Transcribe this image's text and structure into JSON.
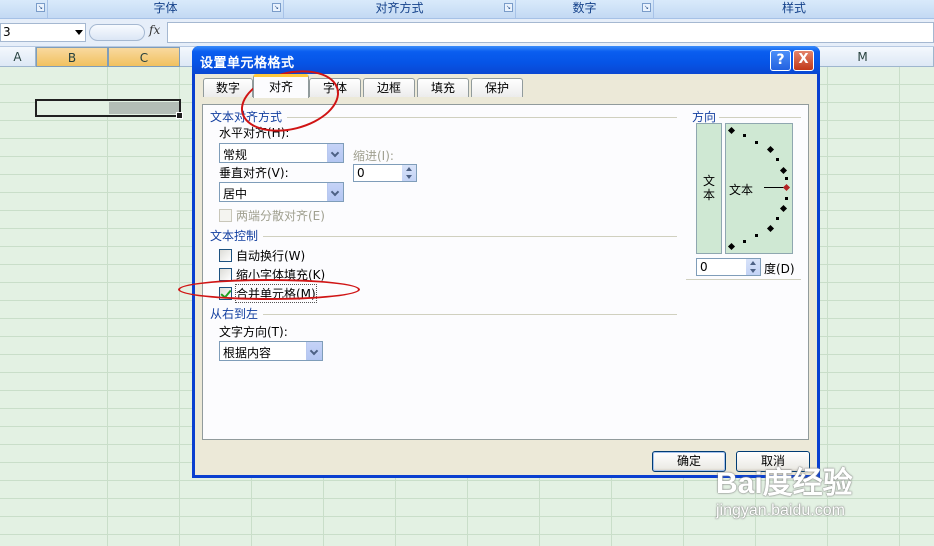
{
  "ribbon": {
    "groups": [
      "字体",
      "对齐方式",
      "数字",
      "样式"
    ]
  },
  "formula_bar": {
    "name_box": "3",
    "fx": "fx"
  },
  "columns": [
    "A",
    "B",
    "C",
    "M"
  ],
  "dialog": {
    "title": "设置单元格格式",
    "help_label": "?",
    "close_label": "X",
    "tabs": [
      "数字",
      "对齐",
      "字体",
      "边框",
      "填充",
      "保护"
    ],
    "active_tab": "对齐",
    "text_alignment": {
      "group_label": "文本对齐方式",
      "horizontal_label": "水平对齐(H):",
      "horizontal_value": "常规",
      "indent_label": "缩进(I):",
      "indent_value": "0",
      "vertical_label": "垂直对齐(V):",
      "vertical_value": "居中",
      "justify_distributed_label": "两端分散对齐(E)"
    },
    "text_control": {
      "group_label": "文本控制",
      "wrap_label": "自动换行(W)",
      "wrap_checked": false,
      "shrink_label": "缩小字体填充(K)",
      "shrink_checked": false,
      "merge_label": "合并单元格(M)",
      "merge_checked": true
    },
    "rtl": {
      "group_label": "从右到左",
      "direction_label": "文字方向(T):",
      "direction_value": "根据内容"
    },
    "orientation": {
      "group_label": "方向",
      "vertical_text": "文本",
      "dial_text": "文本",
      "degrees_value": "0",
      "degrees_label": "度(D)"
    },
    "ok_label": "确定",
    "cancel_label": "取消"
  },
  "watermark": {
    "brand": "Bai度经验",
    "url": "jingyan.baidu.com"
  },
  "colors": {
    "title_bar": "#0a5ef0",
    "annotation": "#d01414",
    "dialog_face": "#ece9d8",
    "sheet": "#e3f1e3"
  }
}
